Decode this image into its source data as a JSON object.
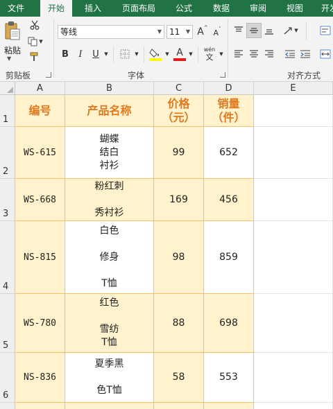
{
  "tabs": [
    "文件",
    "开始",
    "插入",
    "页面布局",
    "公式",
    "数据",
    "审阅",
    "视图",
    "开发"
  ],
  "ribbon": {
    "paste_label": "粘贴",
    "clipboard_label": "剪贴板",
    "font_group_label": "字体",
    "align_group_label": "对齐方式",
    "font_name": "等线",
    "font_size": "11",
    "bold": "B",
    "italic": "I",
    "underline": "U",
    "grow_font": "A",
    "shrink_font": "A",
    "font_color_letter": "A",
    "phonetic_top": "wén",
    "phonetic_bottom": "文"
  },
  "sheet": {
    "columns": [
      "A",
      "B",
      "C",
      "D",
      "E"
    ],
    "rows": [
      "1",
      "2",
      "3",
      "4",
      "5",
      "6"
    ],
    "headers": [
      "编号",
      "产品名称",
      "价格\n（元）",
      "销量\n（件）"
    ],
    "data": [
      {
        "id": "WS-615",
        "name": "蝴蝶\n结白\n衬衫",
        "price": "99",
        "sales": "652"
      },
      {
        "id": "WS-668",
        "name": "粉红刺\n\n秀衬衫",
        "price": "169",
        "sales": "456"
      },
      {
        "id": "NS-815",
        "name": "白色\n\n修身\n\nT恤",
        "price": "98",
        "sales": "859"
      },
      {
        "id": "WS-780",
        "name": "红色\n\n雪纺\nT恤",
        "price": "88",
        "sales": "698"
      },
      {
        "id": "NS-836",
        "name": "夏季黑\n\n色T恤",
        "price": "58",
        "sales": "553"
      }
    ]
  },
  "colors": {
    "ribbon_green": "#217346",
    "header_text": "#e0781d",
    "cell_beige": "#fff2cc",
    "cell_border": "#f5c26b"
  }
}
